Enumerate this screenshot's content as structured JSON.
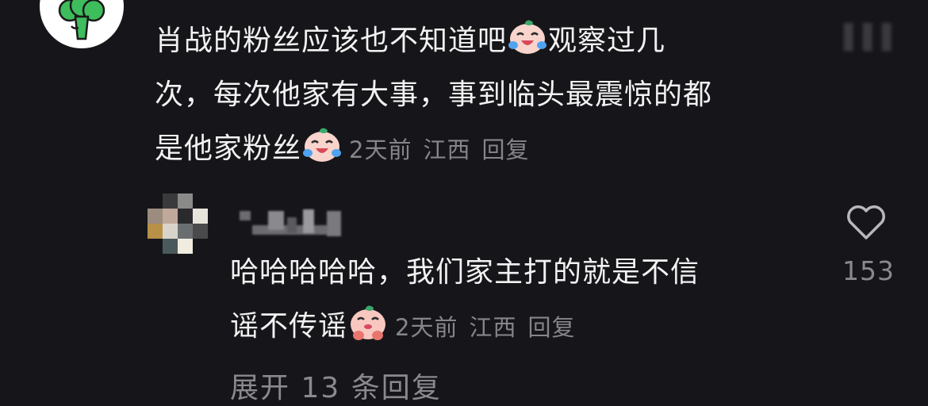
{
  "comment": {
    "line1": "肖战的粉丝应该也不知道吧",
    "line1b": "观察过几",
    "line2": "次，每次他家有大事，事到临头最震惊的都",
    "line3": "是他家粉丝",
    "time": "2天前",
    "location": "江西",
    "reply": "回复",
    "emoji": "crying-laugh-emoji"
  },
  "reply_comment": {
    "line1": "哈哈哈哈哈，我们家主打的就是不信",
    "line2": "谣不传谣",
    "time": "2天前",
    "location": "江西",
    "reply": "回复",
    "like_count": "153",
    "emoji": "pleading-emoji"
  },
  "expand_replies": "展开 13 条回复",
  "colors": {
    "background": "#16161a",
    "text": "#f2f2f2",
    "meta": "#86868a",
    "avatar_icon": "#3dbd5c"
  }
}
